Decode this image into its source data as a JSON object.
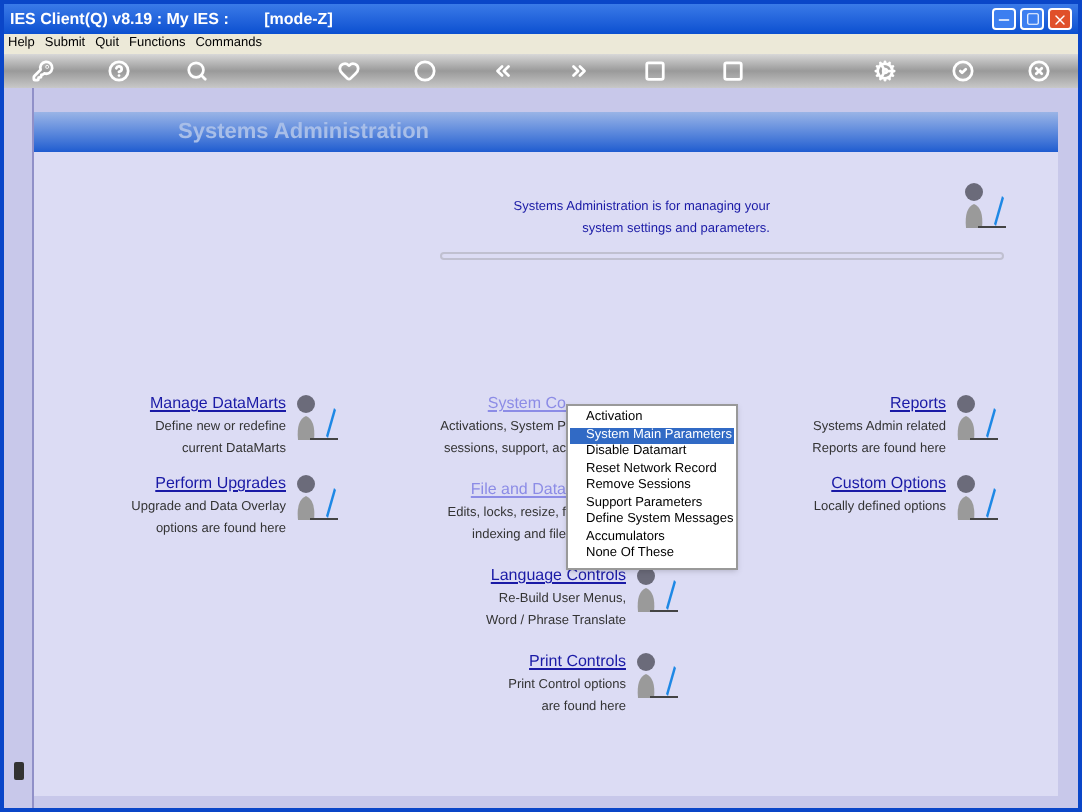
{
  "window": {
    "title": "IES Client(Q) v8.19 : My IES :        [mode-Z]"
  },
  "menu_bar": [
    "Help",
    "Submit",
    "Quit",
    "Functions",
    "Commands"
  ],
  "page_title": "Systems Administration",
  "intro": [
    "Systems Administration is for managing your",
    "system settings and parameters."
  ],
  "columns": [
    [
      {
        "kind": "plain",
        "title": "Manage DataMarts",
        "lines": [
          "Define new or redefine",
          "current DataMarts"
        ]
      },
      {
        "kind": "plain",
        "title": "Perform Upgrades",
        "lines": [
          "Upgrade and Data Overlay",
          "options are found here"
        ]
      }
    ],
    [
      {
        "kind": "covered",
        "title": "System Co",
        "lines": [
          "Activations, System P",
          "sessions, support, ac"
        ]
      },
      {
        "kind": "covered",
        "title": "File and Data",
        "lines": [
          "Edits, locks, resize, f",
          "indexing and file"
        ]
      },
      {
        "kind": "plain",
        "title": "Language Controls",
        "lines": [
          "Re-Build User Menus,",
          "Word / Phrase Translate"
        ]
      },
      {
        "kind": "plain",
        "title": "Print Controls",
        "lines": [
          "Print Control options",
          "are found here"
        ]
      }
    ],
    [
      {
        "kind": "plain",
        "title": "Reports",
        "lines": [
          "Systems Admin related",
          "Reports are found here"
        ]
      },
      {
        "kind": "plain",
        "title": "Custom Options",
        "lines": [
          "Locally defined options"
        ]
      }
    ]
  ],
  "context_menu": [
    {
      "label": "Activation",
      "selected": false
    },
    {
      "label": "System Main Parameters",
      "selected": true
    },
    {
      "label": "Disable Datamart",
      "selected": false
    },
    {
      "label": "Reset Network Record",
      "selected": false
    },
    {
      "label": "Remove Sessions",
      "selected": false
    },
    {
      "label": "Support Parameters",
      "selected": false
    },
    {
      "label": "Define System Messages",
      "selected": false
    },
    {
      "label": "Accumulators",
      "selected": false
    },
    {
      "label": "None Of These",
      "selected": false
    }
  ]
}
